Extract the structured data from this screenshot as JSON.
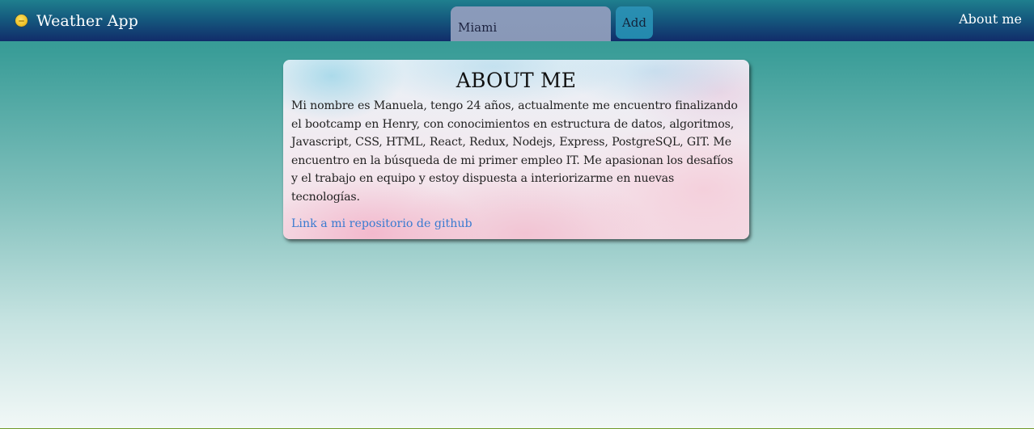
{
  "navbar": {
    "brand_icon": "weather-sun-icon",
    "brand_title": "Weather App",
    "search": {
      "value": "Miami",
      "placeholder": ""
    },
    "add_label": "Add",
    "about_label": "About me"
  },
  "about": {
    "title": "ABOUT ME",
    "body": "Mi nombre es Manuela, tengo 24 años, actualmente me encuentro finalizando el bootcamp en Henry, con conocimientos en estructura de datos, algoritmos, Javascript, CSS, HTML, React, Redux, Nodejs, Express, PostgreSQL, GIT. Me encuentro en la búsqueda de mi primer empleo IT. Me apasionan los desafíos y el trabajo en equipo y estoy dispuesta a interiorizarme en nuevas tecnologías.",
    "link_text": "Link a mi repositorio de github"
  },
  "colors": {
    "navbar": "#112c6a",
    "link": "#3a7bd0",
    "add_button": "#2389ae"
  }
}
